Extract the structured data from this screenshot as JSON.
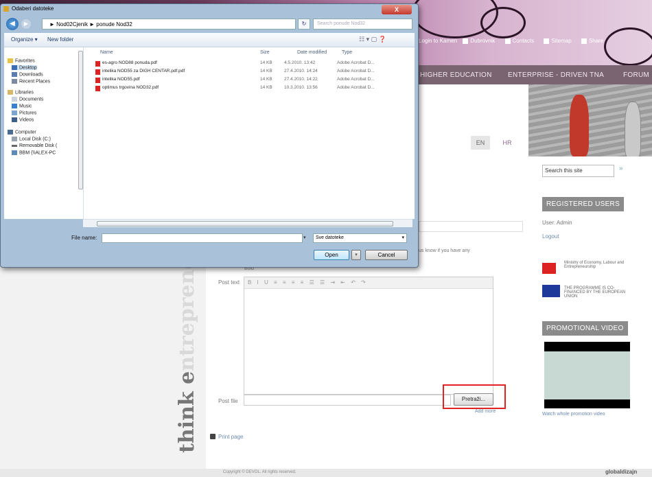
{
  "web": {
    "top_links": [
      "Login to Kamen",
      "Dubrovnik",
      "Contacts",
      "Sitemap",
      "Share"
    ],
    "nav": [
      "HIGHER EDUCATION",
      "ENTERPRISE - DRIVEN TNA",
      "FORUM"
    ],
    "lang_en": "EN",
    "lang_hr": "HR",
    "search_placeholder": "Search this site",
    "search_go": "»",
    "registered_users": "REGISTERED USERS",
    "user": "User: Admin",
    "logout": "Logout",
    "ministry": "Ministry of Economy, Labour and Entrepreneurship",
    "eu": "THE PROGRAMME IS CO-FINANCED BY THE EUROPEAN UNION",
    "promo_title": "PROMOTIONAL VIDEO",
    "watch": "Watch whole promotion video",
    "vertical_text_bold": "think e",
    "vertical_text_light": "ntrepreneurship",
    "email_hint": "us know if you have any",
    "bold_text": "Bold",
    "post_text_label": "Post text",
    "editor_toolbar": "B I U ≡ ≡ ≡ ≡ ☰ ☰ ⇥ ⇤ ↶ ↷",
    "post_file_label": "Post file",
    "browse": "Pretraži...",
    "add_more": "Add more",
    "print_page": "Print page",
    "copyright": "Copyright © DEVOL. All rights reserved.",
    "footer_logo": "globaldizajn"
  },
  "dialog": {
    "title": "Odaberi datoteke",
    "close": "X",
    "address": "► Nod02Cjenik ► ponude Nod32",
    "search_placeholder": "Search ponude Nod32",
    "organize": "Organize ▾",
    "new_folder": "New folder",
    "view_icons": "☷ ▾  ▢  ❓",
    "nav": {
      "favorites": "Favorites",
      "desktop": "Desktop",
      "downloads": "Downloads",
      "recent": "Recent Places",
      "libraries": "Libraries",
      "documents": "Documents",
      "music": "Music",
      "pictures": "Pictures",
      "videos": "Videos",
      "computer": "Computer",
      "local_disk": "Local Disk (C:)",
      "removable": "Removable Disk (",
      "network": "BBM (\\\\ALEX-PC"
    },
    "columns": {
      "name": "Name",
      "size": "Size",
      "date": "Date modified",
      "type": "Type"
    },
    "files": [
      {
        "name": "es-agro NOD88 ponuda.pdf",
        "size": "14 KB",
        "date": "4.5.2010. 13:42",
        "type": "Adobe Acrobat D..."
      },
      {
        "name": "intelika NOD55 za DIGH CENTAR.pdf.pdf",
        "size": "14 KB",
        "date": "27.4.2010. 14:24",
        "type": "Adobe Acrobat D..."
      },
      {
        "name": "intelika NOD55.pdf",
        "size": "14 KB",
        "date": "27.4.2010. 14:22",
        "type": "Adobe Acrobat D..."
      },
      {
        "name": "optimus trgovina NOD32.pdf",
        "size": "14 KB",
        "date": "10.3.2010. 13:56",
        "type": "Adobe Acrobat D..."
      }
    ],
    "file_name_label": "File name:",
    "file_type": "Sve datoteke",
    "open": "Open",
    "cancel": "Cancel"
  }
}
